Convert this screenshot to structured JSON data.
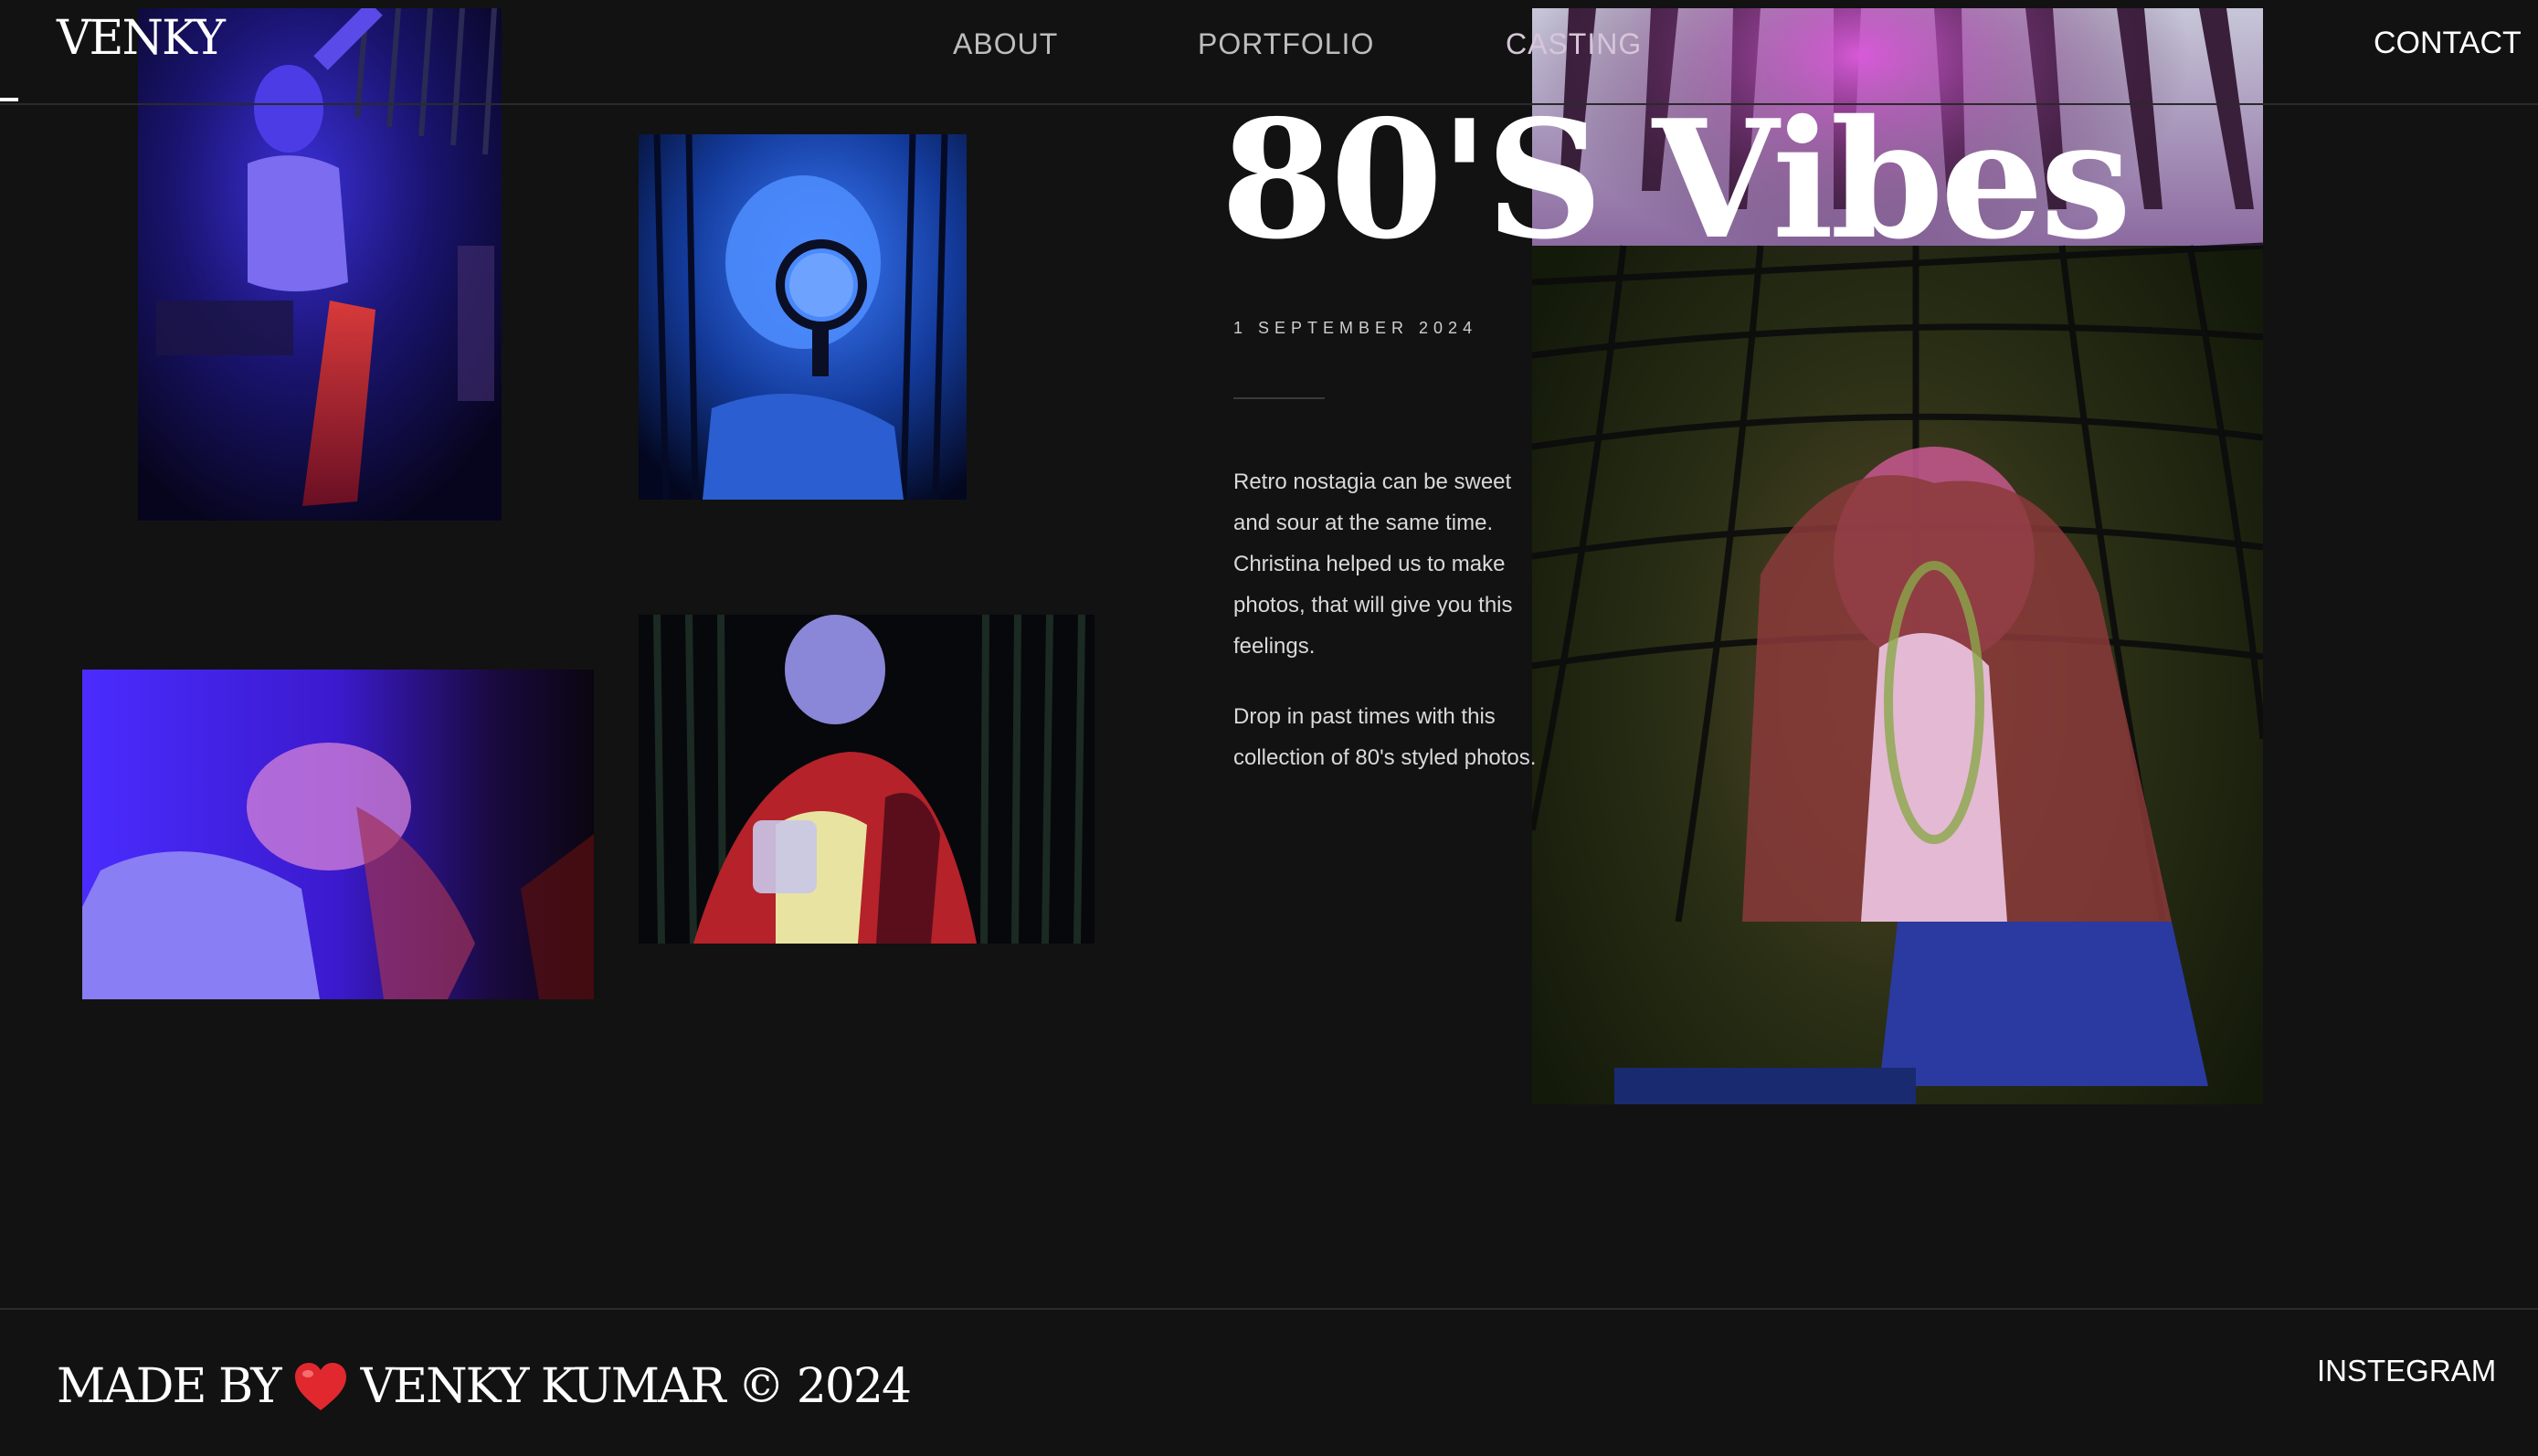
{
  "header": {
    "logo": "VENKY",
    "nav": {
      "about": "ABOUT",
      "portfolio": "PORTFOLIO",
      "casting": "CASTING"
    },
    "contact": "CONTACT"
  },
  "article": {
    "title": "80'S Vibes",
    "date": "1 SEPTEMBER 2024",
    "paragraphs": [
      "Retro nostagia can be sweet and sour at the same time. Christina helped us to make photos, that will give you this feelings.",
      "Drop in past times with this collection of 80's styled photos."
    ]
  },
  "footer": {
    "credit_prefix": "MADE BY",
    "credit_suffix": "VENKY KUMAR © 2024",
    "instagram": "INSTEGRAM"
  },
  "theme": {
    "background": "#121212",
    "text": "#ffffff",
    "accent_heart": "#e0282e"
  },
  "icons": {
    "heart": "heart-icon"
  }
}
